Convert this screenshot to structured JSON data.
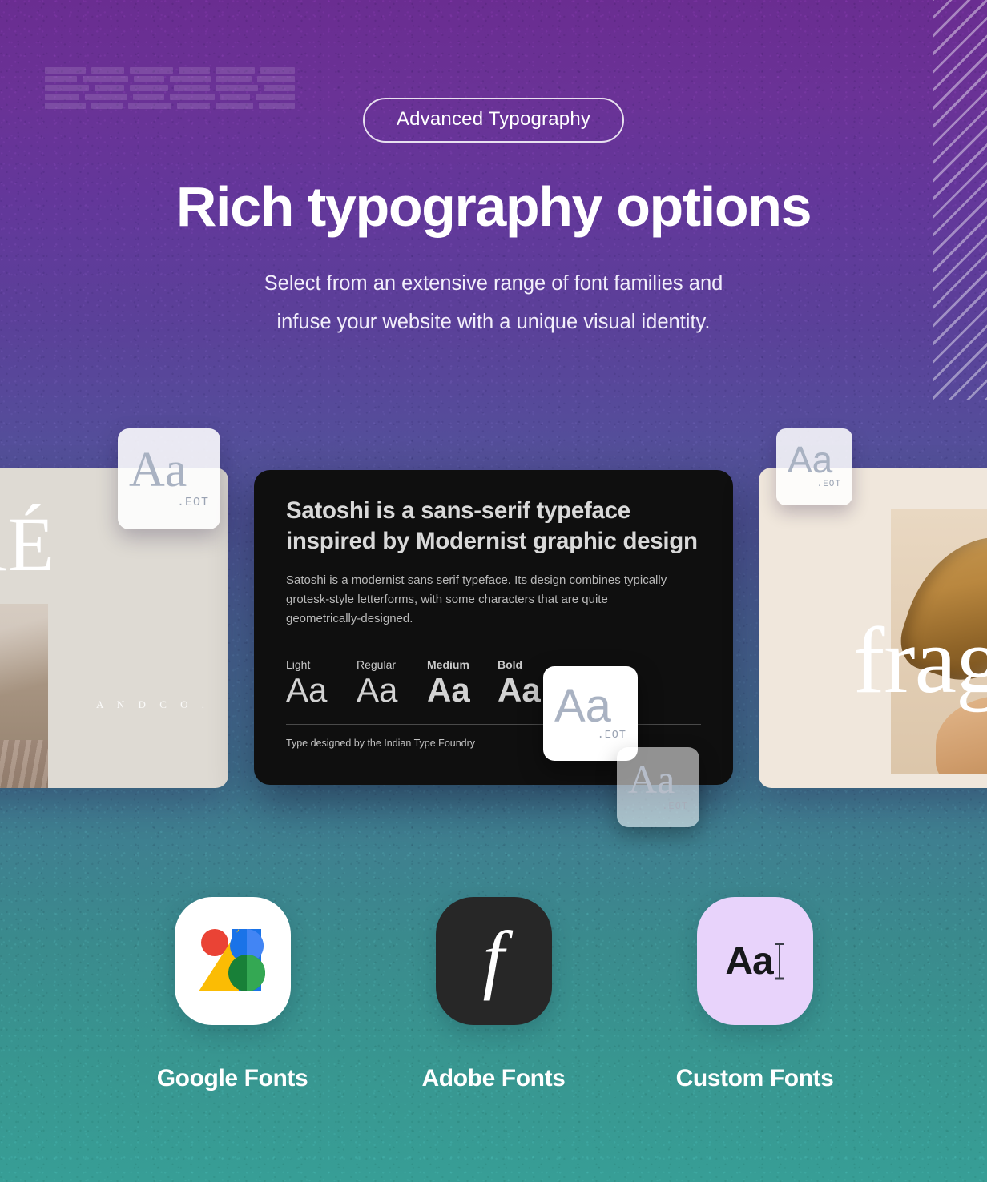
{
  "hero": {
    "pill_label": "Advanced Typography",
    "title": "Rich typography options",
    "subtitle_line1": "Select from an extensive range of font families and",
    "subtitle_line2": "infuse your website with a unique visual identity."
  },
  "cards": {
    "left": {
      "display_word": "ORÉ",
      "tagline": "A N D   C O ."
    },
    "dark": {
      "heading": "Satoshi is a sans-serif typeface inspired by Modernist graphic design",
      "body": "Satoshi is a modernist sans serif typeface. Its design combines typically grotesk-style letterforms, with some characters that are quite geometrically-designed.",
      "weights": [
        {
          "name": "Light",
          "sample": "Aa"
        },
        {
          "name": "Regular",
          "sample": "Aa"
        },
        {
          "name": "Medium",
          "sample": "Aa"
        },
        {
          "name": "Bold",
          "sample": "Aa"
        }
      ],
      "credit": "Type designed by the Indian Type Foundry"
    },
    "right": {
      "display_word": "frag"
    }
  },
  "font_files": [
    {
      "glyph": "Aa",
      "extension": ".EOT",
      "style": "serif"
    },
    {
      "glyph": "Aa",
      "extension": ".EOT",
      "style": "sans"
    },
    {
      "glyph": "Aa",
      "extension": ".EOT",
      "style": "sans"
    },
    {
      "glyph": "Aa",
      "extension": ".EOT",
      "style": "serif"
    }
  ],
  "apps": [
    {
      "label": "Google Fonts",
      "icon": "google-fonts-icon"
    },
    {
      "label": "Adobe Fonts",
      "icon": "adobe-fonts-icon",
      "glyph": "f"
    },
    {
      "label": "Custom Fonts",
      "icon": "custom-fonts-icon",
      "glyph": "Aa"
    }
  ],
  "colors": {
    "gradient_top": "#6a2d91",
    "gradient_mid": "#4f5897",
    "gradient_bottom": "#379e96",
    "dark_card": "#0f0f0f",
    "left_card": "#dedad3",
    "right_card": "#f0e7dc",
    "custom_tile": "#e8d3fb",
    "adobe_tile": "#272727",
    "google_red": "#ea4335",
    "google_yellow": "#fbbc04",
    "google_blue": "#1a73e8",
    "google_green": "#188038"
  }
}
